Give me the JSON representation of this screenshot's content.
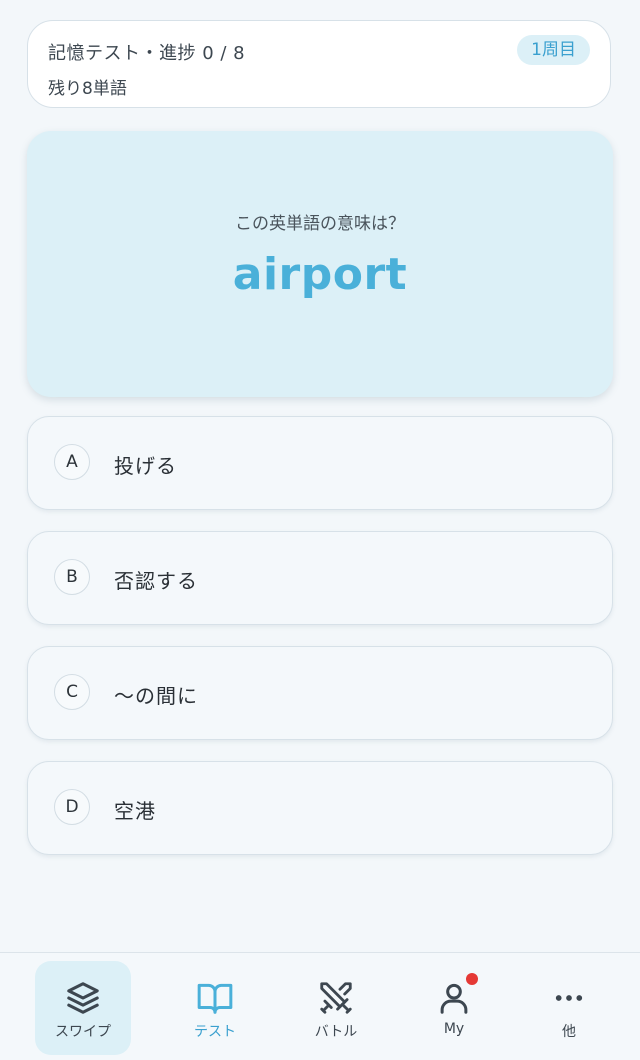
{
  "status": {
    "title": "記憶テスト・進捗 0 / 8",
    "remaining": "残り8単語",
    "round_badge": "1周目"
  },
  "question": {
    "prompt": "この英単語の意味は？",
    "word": "airport"
  },
  "choices": [
    {
      "letter": "A",
      "text": "投げる"
    },
    {
      "letter": "B",
      "text": "否認する"
    },
    {
      "letter": "C",
      "text": "〜の間に"
    },
    {
      "letter": "D",
      "text": "空港"
    }
  ],
  "nav": {
    "items": [
      {
        "label": "スワイプ",
        "icon": "layers-icon"
      },
      {
        "label": "テスト",
        "icon": "book-icon"
      },
      {
        "label": "バトル",
        "icon": "crossed-swords-icon"
      },
      {
        "label": "My",
        "icon": "user-icon"
      },
      {
        "label": "他",
        "icon": "more-dots-icon"
      }
    ]
  },
  "colors": {
    "accent": "#4ab0d9",
    "accent_light": "#dcf0f7",
    "notification": "#e53935"
  }
}
